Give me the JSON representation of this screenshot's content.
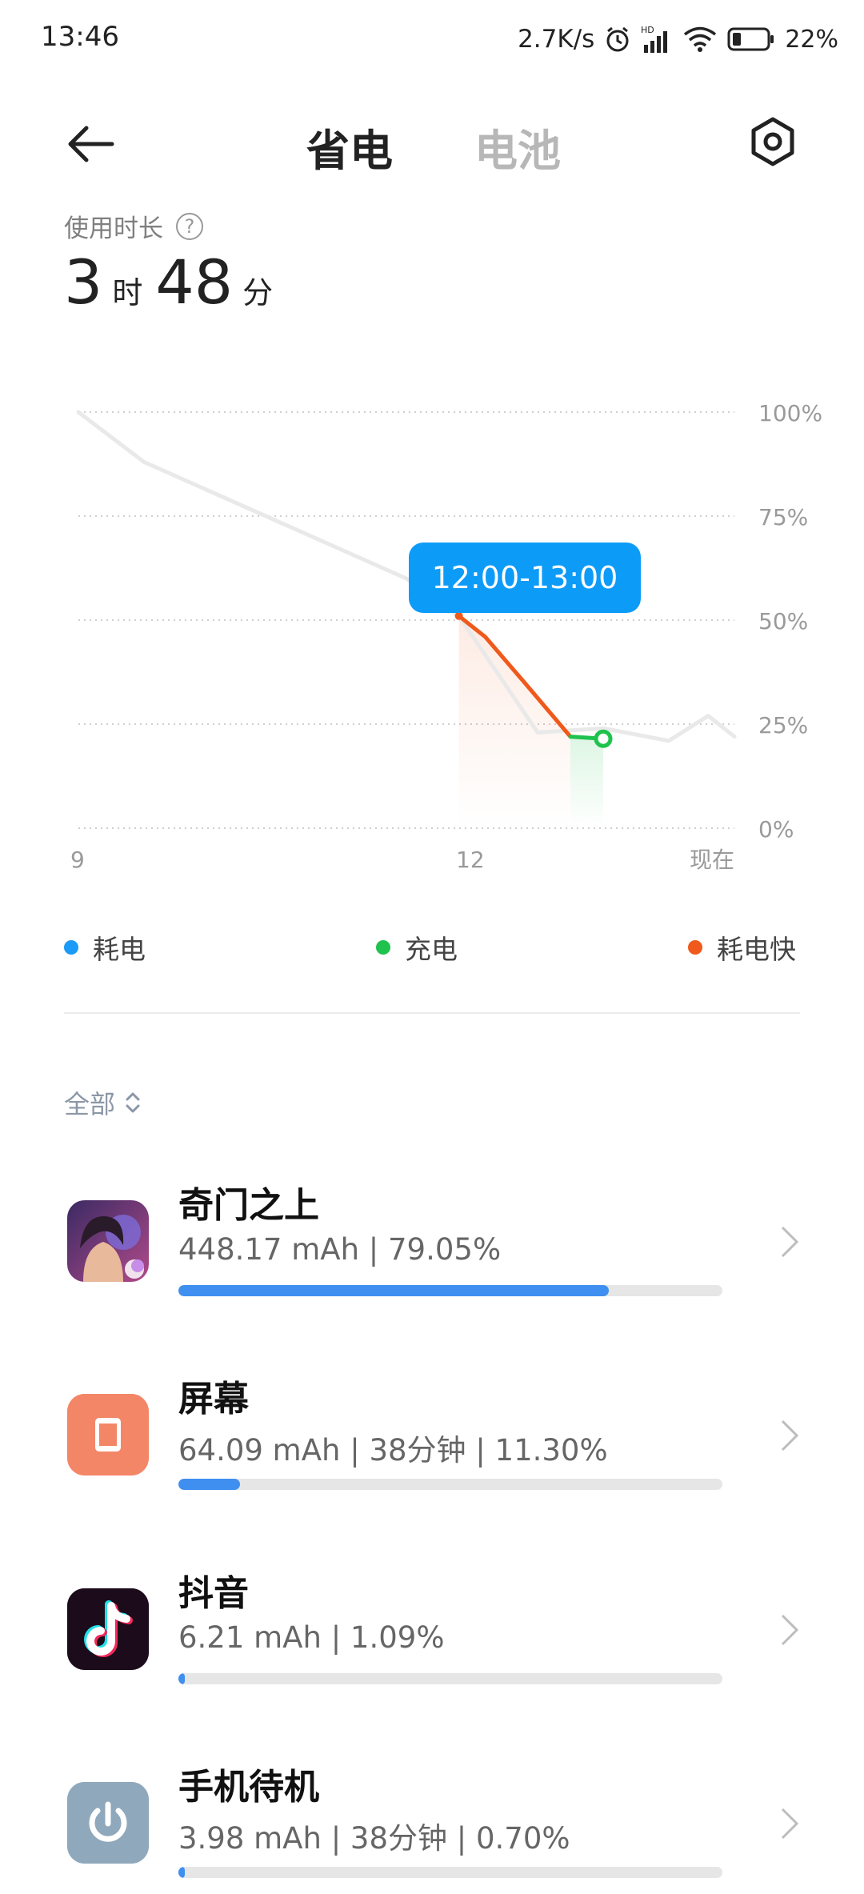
{
  "status_bar": {
    "time": "13:46",
    "net_speed": "2.7K/s",
    "battery": "22%"
  },
  "header": {
    "tab_save": "省电",
    "tab_battery": "电池",
    "icons": {
      "back": "arrow-left-icon",
      "settings": "settings-gear-icon"
    }
  },
  "usage": {
    "label": "使用时长",
    "hours": "3",
    "hours_unit": "时",
    "minutes": "48",
    "minutes_unit": "分"
  },
  "chart_data": {
    "type": "line",
    "title": "",
    "xlabel": "",
    "ylabel": "",
    "x_ticks": [
      "9",
      "12",
      "现在"
    ],
    "y_ticks": [
      "100%",
      "75%",
      "50%",
      "25%",
      "0%"
    ],
    "ylim": [
      0,
      100
    ],
    "xlim": [
      9,
      14
    ],
    "tooltip": "12:00-13:00",
    "series": [
      {
        "name": "耗电",
        "role": "normal",
        "color": "#e9e9e9",
        "x": [
          9.0,
          9.5,
          10.0,
          10.5,
          11.0,
          11.5,
          11.9,
          12.5,
          13.0,
          13.5,
          13.8,
          14.0
        ],
        "y": [
          100,
          88,
          81,
          74,
          67,
          60,
          51,
          23,
          24,
          21,
          27,
          22
        ]
      },
      {
        "name": "耗电快",
        "role": "fast",
        "color": "#f0591c",
        "x": [
          11.9,
          12.1,
          12.4,
          12.75
        ],
        "y": [
          51,
          46,
          35,
          22
        ]
      },
      {
        "name": "充电",
        "role": "charging",
        "color": "#1fc24d",
        "x": [
          12.75,
          13.0
        ],
        "y": [
          22,
          21.5
        ]
      }
    ],
    "legend": [
      {
        "label": "耗电",
        "color": "#1b9af7"
      },
      {
        "label": "充电",
        "color": "#1fc24d"
      },
      {
        "label": "耗电快",
        "color": "#f0591c"
      }
    ]
  },
  "filter": {
    "label": "全部"
  },
  "apps": [
    {
      "name": "奇门之上",
      "stats": "448.17 mAh | 79.05%",
      "percent": 79.05,
      "icon": "game-avatar-icon"
    },
    {
      "name": "屏幕",
      "stats": "64.09 mAh | 38分钟 | 11.30%",
      "percent": 11.3,
      "icon": "screen-icon"
    },
    {
      "name": "抖音",
      "stats": "6.21 mAh | 1.09%",
      "percent": 1.09,
      "icon": "tiktok-icon"
    },
    {
      "name": "手机待机",
      "stats": "3.98 mAh | 38分钟 | 0.70%",
      "percent": 0.7,
      "icon": "power-icon"
    }
  ]
}
